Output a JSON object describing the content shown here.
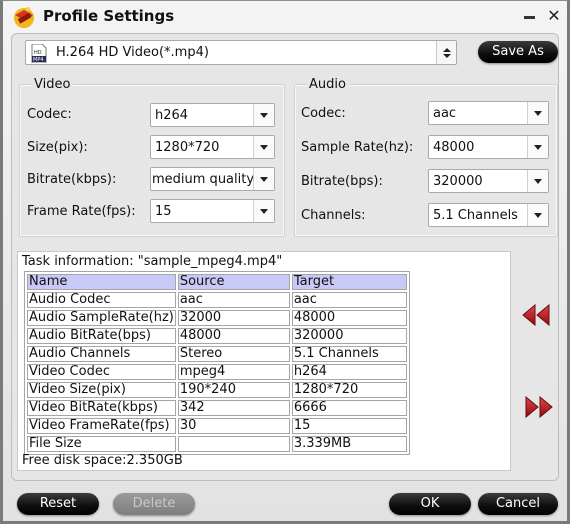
{
  "window": {
    "title": "Profile Settings",
    "minimize_label": "",
    "close_label": "✕"
  },
  "profile": {
    "selected": "H.264 HD Video(*.mp4)",
    "icon": "hd-mp4-file-icon",
    "save_as_label": "Save As"
  },
  "video": {
    "group_title": "Video",
    "fields": [
      {
        "label": "Codec:",
        "value": "h264"
      },
      {
        "label": "Size(pix):",
        "value": "1280*720"
      },
      {
        "label": "Bitrate(kbps):",
        "value": "medium quality"
      },
      {
        "label": "Frame Rate(fps):",
        "value": "15"
      }
    ]
  },
  "audio": {
    "group_title": "Audio",
    "fields": [
      {
        "label": "Codec:",
        "value": "aac"
      },
      {
        "label": "Sample Rate(hz):",
        "value": "48000"
      },
      {
        "label": "Bitrate(bps):",
        "value": "320000"
      },
      {
        "label": "Channels:",
        "value": "5.1 Channels"
      }
    ]
  },
  "task": {
    "title": "Task information: \"sample_mpeg4.mp4\"",
    "columns": [
      "Name",
      "Source",
      "Target"
    ],
    "rows": [
      [
        "Audio Codec",
        "aac",
        "aac"
      ],
      [
        "Audio SampleRate(hz)",
        "32000",
        "48000"
      ],
      [
        "Audio BitRate(bps)",
        "48000",
        "320000"
      ],
      [
        "Audio Channels",
        "Stereo",
        "5.1 Channels"
      ],
      [
        "Video Codec",
        "mpeg4",
        "h264"
      ],
      [
        "Video Size(pix)",
        "190*240",
        "1280*720"
      ],
      [
        "Video BitRate(kbps)",
        "342",
        "6666"
      ],
      [
        "Video FrameRate(fps)",
        "30",
        "15"
      ],
      [
        "File Size",
        "",
        "3.339MB"
      ]
    ],
    "free_disk": "Free disk space:2.350GB",
    "header_color": "#c9c9f7"
  },
  "buttons": {
    "reset": "Reset",
    "delete": "Delete",
    "ok": "OK",
    "cancel": "Cancel"
  },
  "colors": {
    "arrow_red": "#b3141c",
    "button_black": "#0d0d0d"
  }
}
